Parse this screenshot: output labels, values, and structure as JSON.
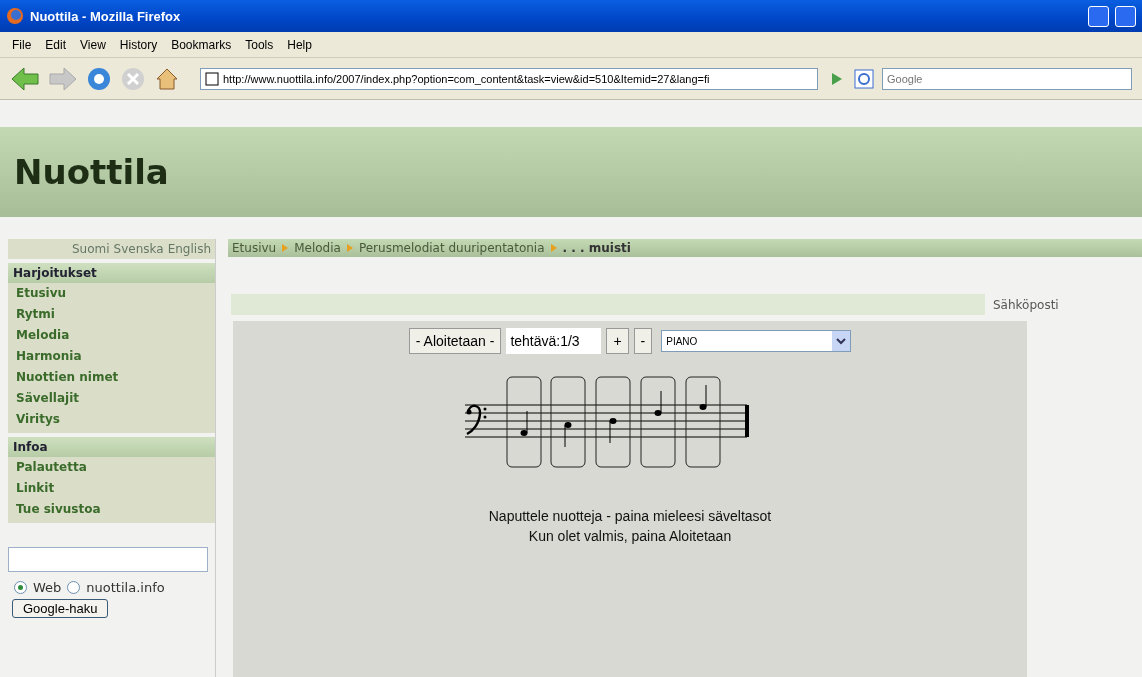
{
  "window": {
    "title": "Nuottila - Mozilla Firefox"
  },
  "menu": [
    "File",
    "Edit",
    "View",
    "History",
    "Bookmarks",
    "Tools",
    "Help"
  ],
  "address": {
    "value": "http://www.nuottila.info/2007/index.php?option=com_content&task=view&id=510&Itemid=27&lang=fi"
  },
  "search": {
    "placeholder": "Google"
  },
  "site": {
    "title": "Nuottila"
  },
  "languages": [
    "Suomi",
    "Svenska",
    "English"
  ],
  "sidebar": [
    {
      "heading": "Harjoitukset",
      "items": [
        "Etusivu",
        "Rytmi",
        "Melodia",
        "Harmonia",
        "Nuottien nimet",
        "Sävellajit",
        "Viritys"
      ]
    },
    {
      "heading": "Infoa",
      "items": [
        "Palautetta",
        "Linkit",
        "Tue sivustoa"
      ]
    }
  ],
  "google": {
    "options": [
      {
        "label": "Web",
        "selected": true
      },
      {
        "label": "nuottila.info",
        "selected": false
      }
    ],
    "button": "Google-haku"
  },
  "breadcrumb": [
    "Etusivu",
    "Melodia",
    "Perusmelodiat duuripentatonia",
    ". . . muisti"
  ],
  "email": "Sähköposti",
  "exercise": {
    "start": "- Aloitetaan -",
    "task": "tehtävä:1/3",
    "plus": "+",
    "minus": "-",
    "instrument": "PIANO",
    "lines": [
      "Naputtele nuotteja - paina mieleesi säveltasot",
      "Kun olet valmis, paina Aloitetaan"
    ]
  }
}
